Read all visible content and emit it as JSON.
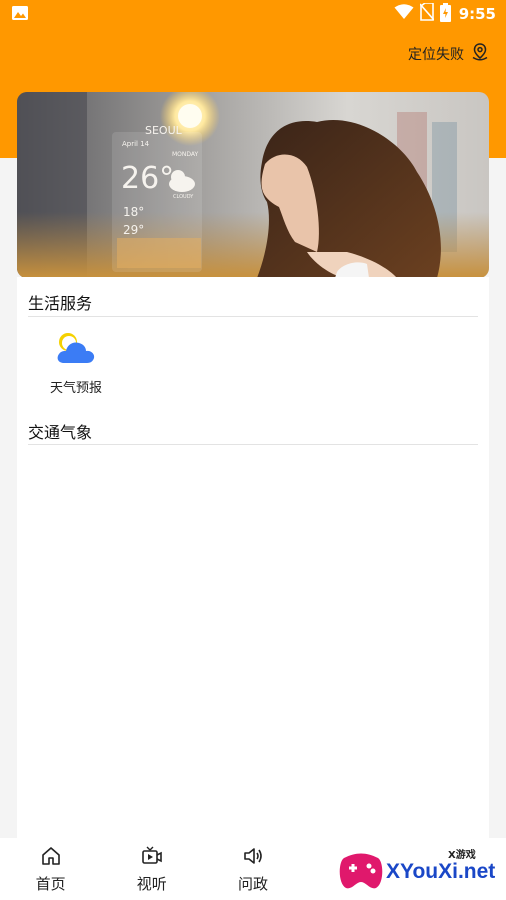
{
  "status_bar": {
    "time": "9:55"
  },
  "header": {
    "location_label": "定位失败"
  },
  "banner": {
    "widget_city": "SEOUL",
    "widget_date": "April 14",
    "widget_temp": "26°",
    "widget_day": "MONDAY",
    "widget_condition": "CLOUDY",
    "widget_low": "18°",
    "widget_high": "29°"
  },
  "sections": {
    "life_services_title": "生活服务",
    "weather_label": "天气预报",
    "traffic_title": "交通气象"
  },
  "tabbar": {
    "home": "首页",
    "video": "视听",
    "politics": "问政"
  },
  "watermark": {
    "brand": "XYouXi.net",
    "sub": "X游戏"
  }
}
